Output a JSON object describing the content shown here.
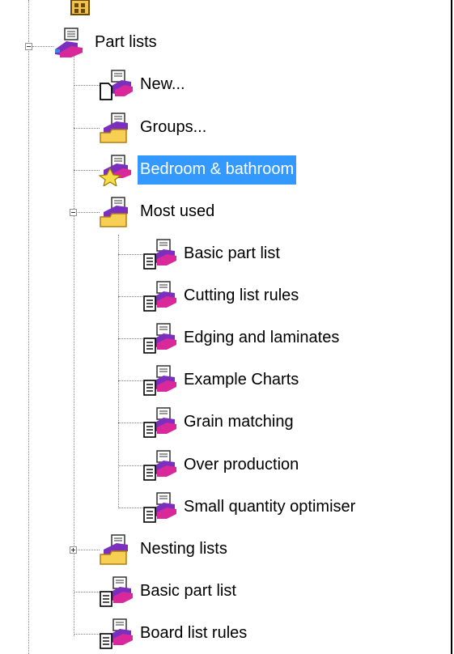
{
  "tree": {
    "root": {
      "label": "Part lists",
      "icon": "part-list-group-icon",
      "expanded": true
    },
    "items": [
      {
        "label": "New...",
        "icon": "new-document-icon"
      },
      {
        "label": "Groups...",
        "icon": "folder-icon"
      },
      {
        "label": "Bedroom & bathroom",
        "icon": "favourite-star-icon",
        "selected": true
      },
      {
        "label": "Most used",
        "icon": "folder-icon",
        "expanded": true,
        "children": [
          {
            "label": "Basic part list",
            "icon": "part-list-icon"
          },
          {
            "label": "Cutting list rules",
            "icon": "part-list-icon"
          },
          {
            "label": "Edging and laminates",
            "icon": "part-list-icon"
          },
          {
            "label": "Example Charts",
            "icon": "part-list-icon"
          },
          {
            "label": "Grain matching",
            "icon": "part-list-icon"
          },
          {
            "label": "Over production",
            "icon": "part-list-icon"
          },
          {
            "label": "Small quantity optimiser",
            "icon": "part-list-icon"
          }
        ]
      },
      {
        "label": "Nesting lists",
        "icon": "folder-icon",
        "expanded": false
      },
      {
        "label": "Basic part list",
        "icon": "part-list-icon"
      },
      {
        "label": "Board list rules",
        "icon": "part-list-icon"
      }
    ]
  },
  "colors": {
    "selection": "#3399ff",
    "purple": "#7b2fbf",
    "magenta": "#d8289a",
    "folder": "#f7cf52"
  }
}
